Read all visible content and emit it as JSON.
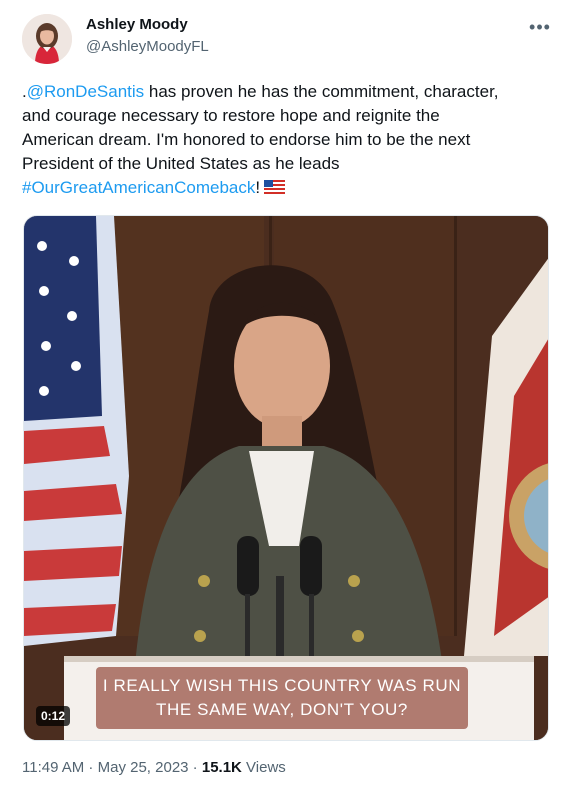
{
  "author": {
    "display_name": "Ashley Moody",
    "handle": "@AshleyMoodyFL",
    "avatar_icon": "profile-photo-avatar"
  },
  "more_icon": "more-horizontal-icon",
  "tweet": {
    "lines": [
      {
        "prefix": ".",
        "mention": "@RonDeSantis",
        "text": " has proven he has the commitment, character,"
      },
      {
        "text": "and courage necessary to restore hope and reignite the"
      },
      {
        "text": "American dream. I'm honored to endorse him to be the next"
      },
      {
        "text": "President of the United States as he leads"
      },
      {
        "hashtag": "#OurGreatAmericanComeback",
        "suffix": "!",
        "emoji": "us-flag-emoji"
      }
    ]
  },
  "media": {
    "type": "video",
    "caption_lines": [
      "I REALLY WISH THIS COUNTRY WAS RUN",
      "THE SAME WAY, DON'T YOU?"
    ],
    "duration": "0:12"
  },
  "meta": {
    "time": "11:49 AM",
    "separator": " · ",
    "date": "May 25, 2023",
    "views_count": "15.1K",
    "views_label": " Views"
  },
  "colors": {
    "link": "#1d9bf0",
    "secondary_text": "#536471",
    "primary_text": "#0f1419",
    "caption_bg": "#b07b70"
  }
}
